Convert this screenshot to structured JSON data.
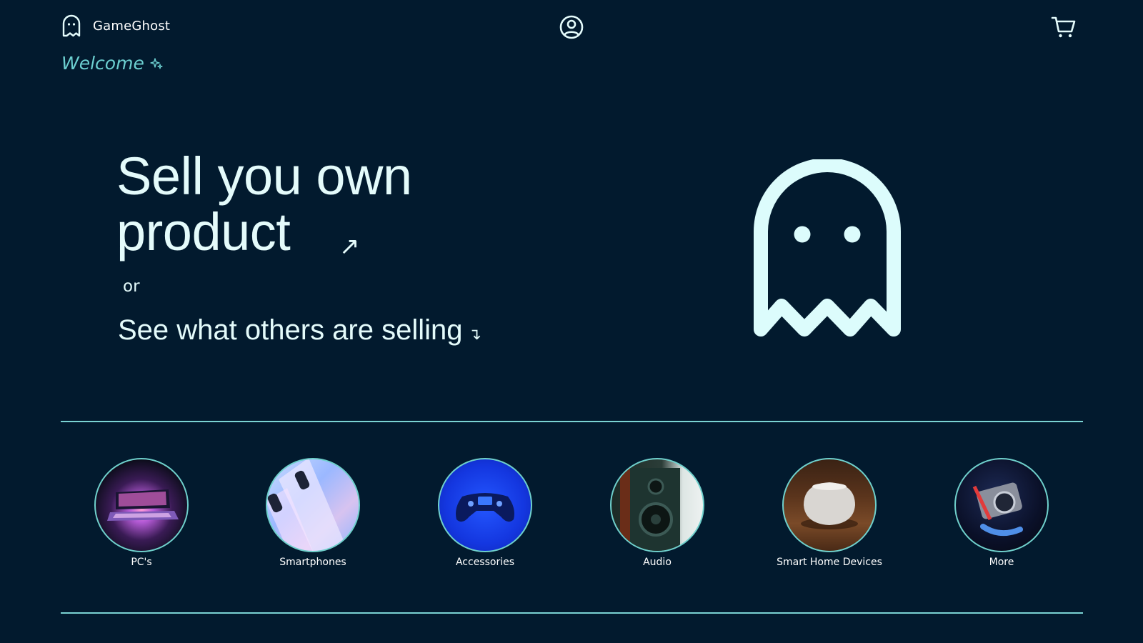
{
  "header": {
    "brand_name": "GameGhost",
    "account_icon": "user-circle-icon",
    "cart_icon": "shopping-cart-icon"
  },
  "welcome": {
    "text": "Welcome",
    "icon": "sparkle-icon"
  },
  "hero": {
    "title": "Sell you own product",
    "title_arrow": "↗",
    "or_text": "or",
    "see_link": "See what others are selling",
    "see_arrow": "↴",
    "illustration": "ghost-icon"
  },
  "categories": [
    {
      "label": "PC's",
      "image": "laptop-photo"
    },
    {
      "label": "Smartphones",
      "image": "smartphones-photo"
    },
    {
      "label": "Accessories",
      "image": "gamepad-photo"
    },
    {
      "label": "Audio",
      "image": "speaker-photo"
    },
    {
      "label": "Smart Home Devices",
      "image": "smart-speaker-photo"
    },
    {
      "label": "More",
      "image": "camera-photo"
    }
  ],
  "colors": {
    "background": "#021a2e",
    "accent": "#6ccfd0",
    "text": "#e4fbfb",
    "divider": "#7ad3d3"
  }
}
